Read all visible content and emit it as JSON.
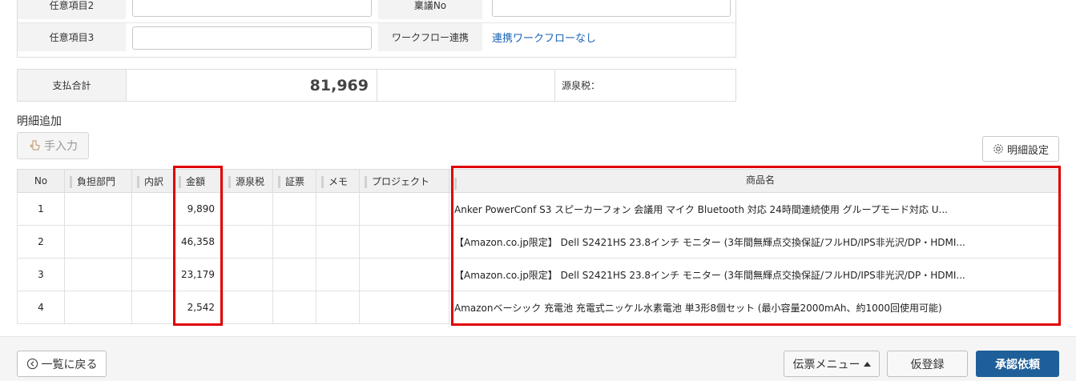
{
  "form": {
    "row1": {
      "label_left": "任意項目2",
      "label_right": "稟議No"
    },
    "row2": {
      "label_left": "任意項目3",
      "label_right": "ワークフロー連携",
      "workflow_link": "連携ワークフローなし"
    }
  },
  "total": {
    "label": "支払合計",
    "amount": "81,969",
    "withholding_label": "源泉税："
  },
  "details": {
    "section_title": "明細追加",
    "manual_button": "手入力",
    "settings_button": "明細設定",
    "columns": [
      "No",
      "負担部門",
      "内訳",
      "金額",
      "源泉税",
      "証票",
      "メモ",
      "プロジェクト",
      "商品名"
    ],
    "rows": [
      {
        "no": "1",
        "amount": "9,890",
        "name": "Anker PowerConf S3 スピーカーフォン 会議用 マイク Bluetooth 対応 24時間連続使用 グループモード対応 U..."
      },
      {
        "no": "2",
        "amount": "46,358",
        "name": "【Amazon.co.jp限定】 Dell S2421HS 23.8インチ モニター (3年間無輝点交換保証/フルHD/IPS非光沢/DP・HDMI..."
      },
      {
        "no": "3",
        "amount": "23,179",
        "name": "【Amazon.co.jp限定】 Dell S2421HS 23.8インチ モニター (3年間無輝点交換保証/フルHD/IPS非光沢/DP・HDMI..."
      },
      {
        "no": "4",
        "amount": "2,542",
        "name": "Amazonベーシック 充電池 充電式ニッケル水素電池 単3形8個セット (最小容量2000mAh、約1000回使用可能)"
      }
    ]
  },
  "footer": {
    "back_button": "一覧に戻る",
    "menu_button": "伝票メニュー",
    "draft_button": "仮登録",
    "approve_button": "承認依頼"
  },
  "colors": {
    "highlight": "#e00000",
    "primary": "#1f5f99",
    "link": "#1a63b5"
  }
}
